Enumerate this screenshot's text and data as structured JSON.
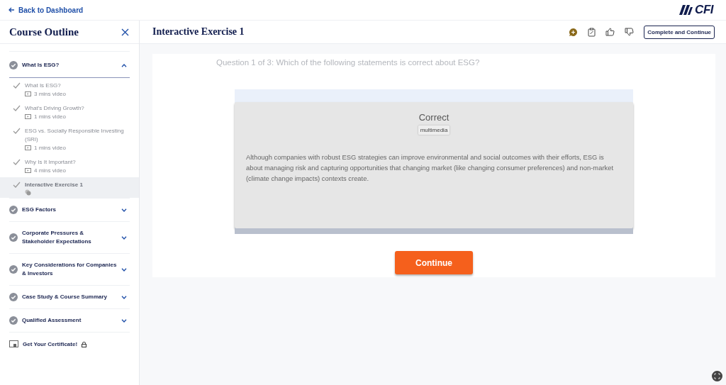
{
  "back_link": "Back to Dashboard",
  "logo": {
    "text": "CFI"
  },
  "sidebar": {
    "title": "Course Outline",
    "sections": [
      {
        "title": "What Is ESG?",
        "completed": true,
        "expanded": true,
        "lessons": [
          {
            "title": "What Is ESG?",
            "meta": "3 mins video",
            "kind": "video",
            "completed": true,
            "selected": false
          },
          {
            "title": "What's Driving Growth?",
            "meta": "1 mins video",
            "kind": "video",
            "completed": true,
            "selected": false
          },
          {
            "title": "ESG vs. Socially Responsible Investing (SRI)",
            "meta": "1 mins video",
            "kind": "video",
            "completed": true,
            "selected": false
          },
          {
            "title": "Why Is It Important?",
            "meta": "4 mins video",
            "kind": "video",
            "completed": true,
            "selected": false
          },
          {
            "title": "Interactive Exercise 1",
            "kind": "interactive",
            "completed": true,
            "selected": true
          }
        ]
      },
      {
        "title": "ESG Factors",
        "completed": true,
        "expanded": false
      },
      {
        "title": "Corporate Pressures & Stakeholder Expectations",
        "completed": true,
        "expanded": false
      },
      {
        "title": "Key Considerations for Companies & Investors",
        "completed": true,
        "expanded": false
      },
      {
        "title": "Case Study & Course Summary",
        "completed": true,
        "expanded": false
      },
      {
        "title": "Qualified Assessment",
        "completed": true,
        "expanded": false
      }
    ],
    "certificate": {
      "label": "Get Your Certificate!",
      "locked": true
    }
  },
  "main": {
    "title": "Interactive Exercise 1",
    "action_button": "Complete and Continue",
    "question": "Question 1 of 3: Which of the following statements is correct about ESG?",
    "feedback": {
      "heading": "Correct",
      "tag": "multimedia",
      "body": "Although companies with robust ESG strategies can improve environmental and social outcomes with their efforts, ESG is about managing risk and capturing opportunities that changing market (like changing consumer preferences) and non-market (climate change impacts) contexts create."
    },
    "continue_button": "Continue"
  }
}
